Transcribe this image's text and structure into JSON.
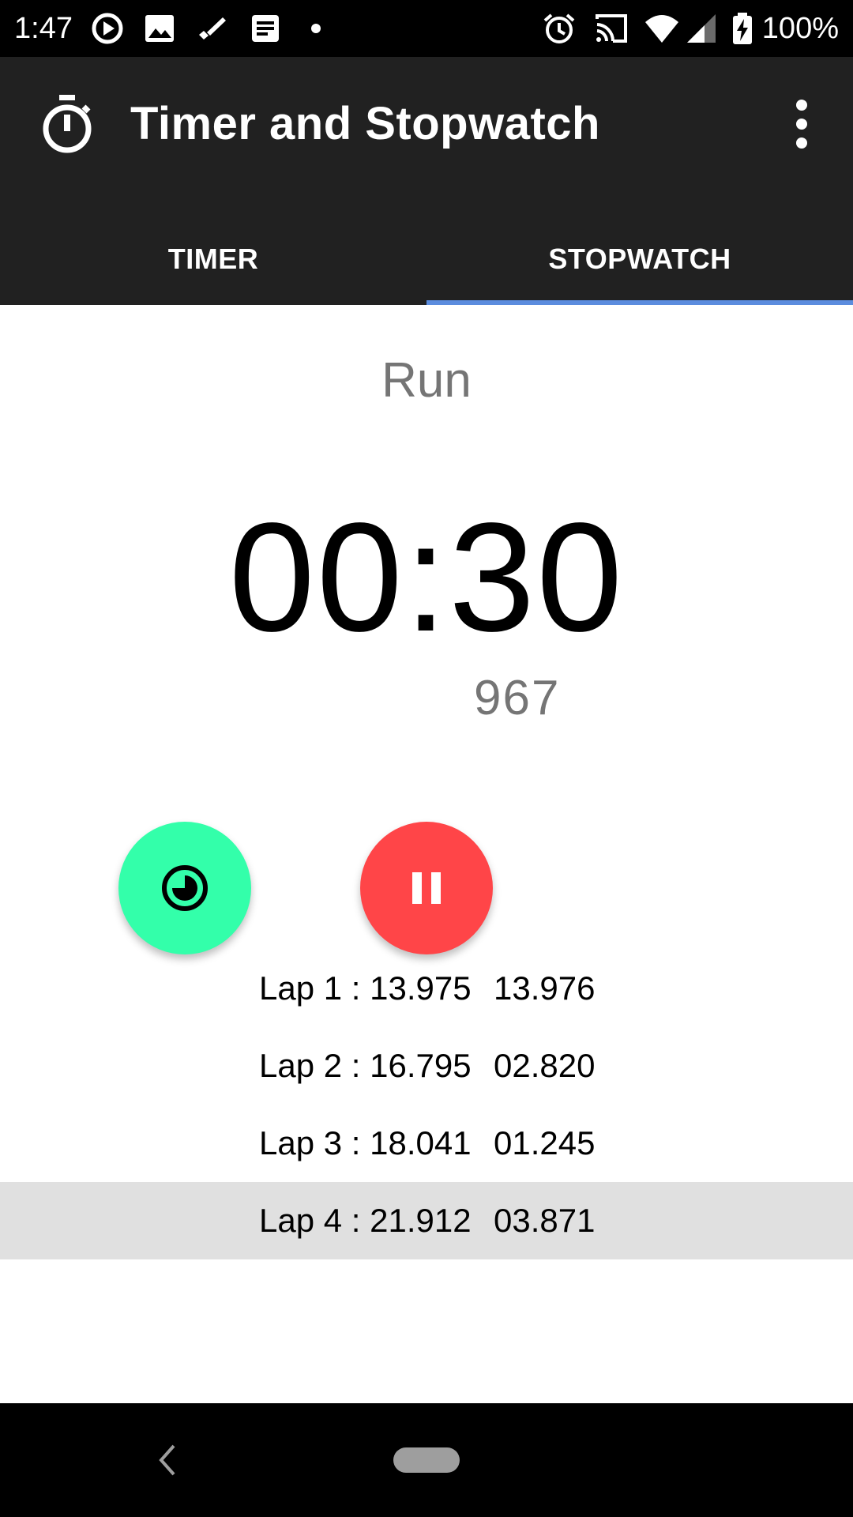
{
  "status_bar": {
    "time": "1:47",
    "battery": "100%",
    "left_icons": [
      "play-circle-icon",
      "image-icon",
      "pen-icon",
      "notes-icon",
      "dot-icon"
    ],
    "right_icons": [
      "alarm-icon",
      "cast-icon",
      "wifi-icon",
      "signal-icon",
      "battery-charging-icon"
    ]
  },
  "app_bar": {
    "title": "Timer and Stopwatch",
    "icon": "stopwatch-icon",
    "menu_icon": "more-vert-icon"
  },
  "tabs": [
    {
      "label": "TIMER",
      "selected": false
    },
    {
      "label": "STOPWATCH",
      "selected": true
    }
  ],
  "stopwatch": {
    "state": "Run",
    "elapsed": "00:30",
    "milliseconds": "967"
  },
  "buttons": {
    "lap_icon": "lap-timer-icon",
    "pause_icon": "pause-icon"
  },
  "laps": [
    {
      "label": "Lap 1 : 13.975",
      "split": "13.976"
    },
    {
      "label": "Lap 2 : 16.795",
      "split": "02.820"
    },
    {
      "label": "Lap 3 : 18.041",
      "split": "01.245"
    },
    {
      "label": "Lap 4 : 21.912",
      "split": "03.871"
    }
  ],
  "colors": {
    "app_bar": "#212121",
    "tab_indicator": "#5b8cde",
    "lap_button": "#33ffaa",
    "pause_button": "#ff4548",
    "highlight_row": "#e0e0e0"
  }
}
